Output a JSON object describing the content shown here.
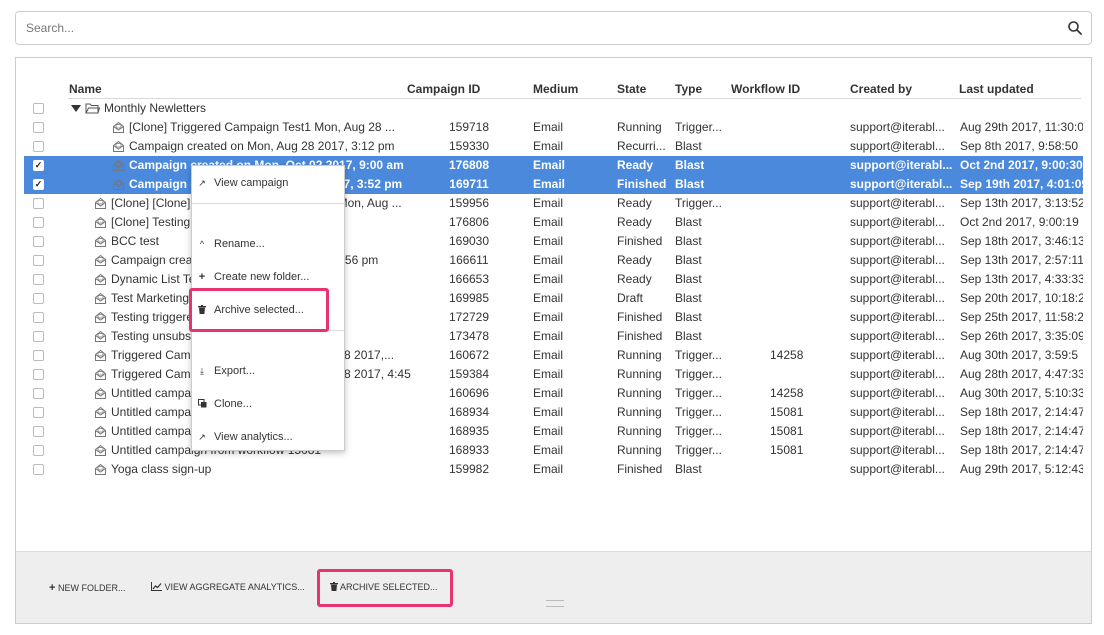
{
  "search": {
    "placeholder": "Search..."
  },
  "table": {
    "headers": {
      "name": "Name",
      "campaign_id": "Campaign ID",
      "medium": "Medium",
      "state": "State",
      "type": "Type",
      "workflow_id": "Workflow ID",
      "created_by": "Created by",
      "last_updated": "Last updated"
    },
    "folder": {
      "label": "Monthly Newletters"
    },
    "rows": [
      {
        "name": "[Clone] Triggered Campaign Test1 Mon, Aug 28 ...",
        "id": "159718",
        "medium": "Email",
        "state": "Running",
        "type": "Trigger...",
        "workflow": "",
        "created_by": "support@iterabl...",
        "updated": "Aug 29th 2017, 11:30:0"
      },
      {
        "name": "Campaign created on Mon, Aug 28 2017, 3:12 pm",
        "id": "159330",
        "medium": "Email",
        "state": "Recurri...",
        "type": "Blast",
        "workflow": "",
        "created_by": "support@iterabl...",
        "updated": "Sep 8th 2017, 9:58:50"
      },
      {
        "name": "Campaign created on Mon, Oct 02 2017, 9:00 am",
        "id": "176808",
        "medium": "Email",
        "state": "Ready",
        "type": "Blast",
        "workflow": "",
        "created_by": "support@iterabl...",
        "updated": "Oct 2nd 2017, 9:00:30"
      },
      {
        "name": "Campaign created on Tue, Sep 19 2017, 3:52 pm",
        "id": "169711",
        "medium": "Email",
        "state": "Finished",
        "type": "Blast",
        "workflow": "",
        "created_by": "support@iterabl...",
        "updated": "Sep 19th 2017, 4:01:09"
      },
      {
        "name": "[Clone] [Clone] Triggered Campaign Test1 Mon, Aug ...",
        "id": "159956",
        "medium": "Email",
        "state": "Ready",
        "type": "Trigger...",
        "workflow": "",
        "created_by": "support@iterabl...",
        "updated": "Sep 13th 2017, 3:13:52"
      },
      {
        "name": "[Clone] Testing unsubscribe",
        "id": "176806",
        "medium": "Email",
        "state": "Ready",
        "type": "Blast",
        "workflow": "",
        "created_by": "support@iterabl...",
        "updated": "Oct 2nd 2017, 9:00:19"
      },
      {
        "name": "BCC test",
        "id": "169030",
        "medium": "Email",
        "state": "Finished",
        "type": "Blast",
        "workflow": "",
        "created_by": "support@iterabl...",
        "updated": "Sep 18th 2017, 3:46:13"
      },
      {
        "name": "Campaign created on Wed, Sep 13 2017, 2:56 pm",
        "id": "166611",
        "medium": "Email",
        "state": "Ready",
        "type": "Blast",
        "workflow": "",
        "created_by": "support@iterabl...",
        "updated": "Sep 13th 2017, 2:57:11"
      },
      {
        "name": "Dynamic List Test",
        "id": "166653",
        "medium": "Email",
        "state": "Ready",
        "type": "Blast",
        "workflow": "",
        "created_by": "support@iterabl...",
        "updated": "Sep 13th 2017, 4:33:33"
      },
      {
        "name": "Test Marketing Campaign",
        "id": "169985",
        "medium": "Email",
        "state": "Draft",
        "type": "Blast",
        "workflow": "",
        "created_by": "support@iterabl...",
        "updated": "Sep 20th 2017, 10:18:2"
      },
      {
        "name": "Testing triggered",
        "id": "172729",
        "medium": "Email",
        "state": "Finished",
        "type": "Blast",
        "workflow": "",
        "created_by": "support@iterabl...",
        "updated": "Sep 25th 2017, 11:58:2"
      },
      {
        "name": "Testing unsubscribe",
        "id": "173478",
        "medium": "Email",
        "state": "Finished",
        "type": "Blast",
        "workflow": "",
        "created_by": "support@iterabl...",
        "updated": "Sep 26th 2017, 3:35:09"
      },
      {
        "name": "Triggered Campaign created on Mon, Aug 28 2017,...",
        "id": "160672",
        "medium": "Email",
        "state": "Running",
        "type": "Trigger...",
        "workflow": "14258",
        "created_by": "support@iterabl...",
        "updated": "Aug 30th 2017, 3:59:5"
      },
      {
        "name": "Triggered Campaign created on Mon, Aug 28 2017, 4:45 p...",
        "id": "159384",
        "medium": "Email",
        "state": "Running",
        "type": "Trigger...",
        "workflow": "",
        "created_by": "support@iterabl...",
        "updated": "Aug 28th 2017, 4:47:33"
      },
      {
        "name": "Untitled campaign from workflow 14258",
        "id": "160696",
        "medium": "Email",
        "state": "Running",
        "type": "Trigger...",
        "workflow": "14258",
        "created_by": "support@iterabl...",
        "updated": "Aug 30th 2017, 5:10:33"
      },
      {
        "name": "Untitled campaign from workflow 15081",
        "id": "168934",
        "medium": "Email",
        "state": "Running",
        "type": "Trigger...",
        "workflow": "15081",
        "created_by": "support@iterabl...",
        "updated": "Sep 18th 2017, 2:14:47"
      },
      {
        "name": "Untitled campaign from workflow 15081",
        "id": "168935",
        "medium": "Email",
        "state": "Running",
        "type": "Trigger...",
        "workflow": "15081",
        "created_by": "support@iterabl...",
        "updated": "Sep 18th 2017, 2:14:47"
      },
      {
        "name": "Untitled campaign from workflow 15081",
        "id": "168933",
        "medium": "Email",
        "state": "Running",
        "type": "Trigger...",
        "workflow": "15081",
        "created_by": "support@iterabl...",
        "updated": "Sep 18th 2017, 2:14:47"
      },
      {
        "name": "Yoga class sign-up",
        "id": "159982",
        "medium": "Email",
        "state": "Finished",
        "type": "Blast",
        "workflow": "",
        "created_by": "support@iterabl...",
        "updated": "Aug 29th 2017, 5:12:43"
      }
    ]
  },
  "context_menu": {
    "view_campaign": "View campaign",
    "rename": "Rename...",
    "create_folder": "Create new folder...",
    "archive": "Archive selected...",
    "export": "Export...",
    "clone": "Clone...",
    "view_analytics": "View analytics..."
  },
  "footer": {
    "new_folder": "NEW FOLDER...",
    "aggregate": "VIEW AGGREGATE ANALYTICS...",
    "archive": "ARCHIVE SELECTED..."
  },
  "colors": {
    "selection": "#4a89dc",
    "highlight": "#e8346e"
  }
}
